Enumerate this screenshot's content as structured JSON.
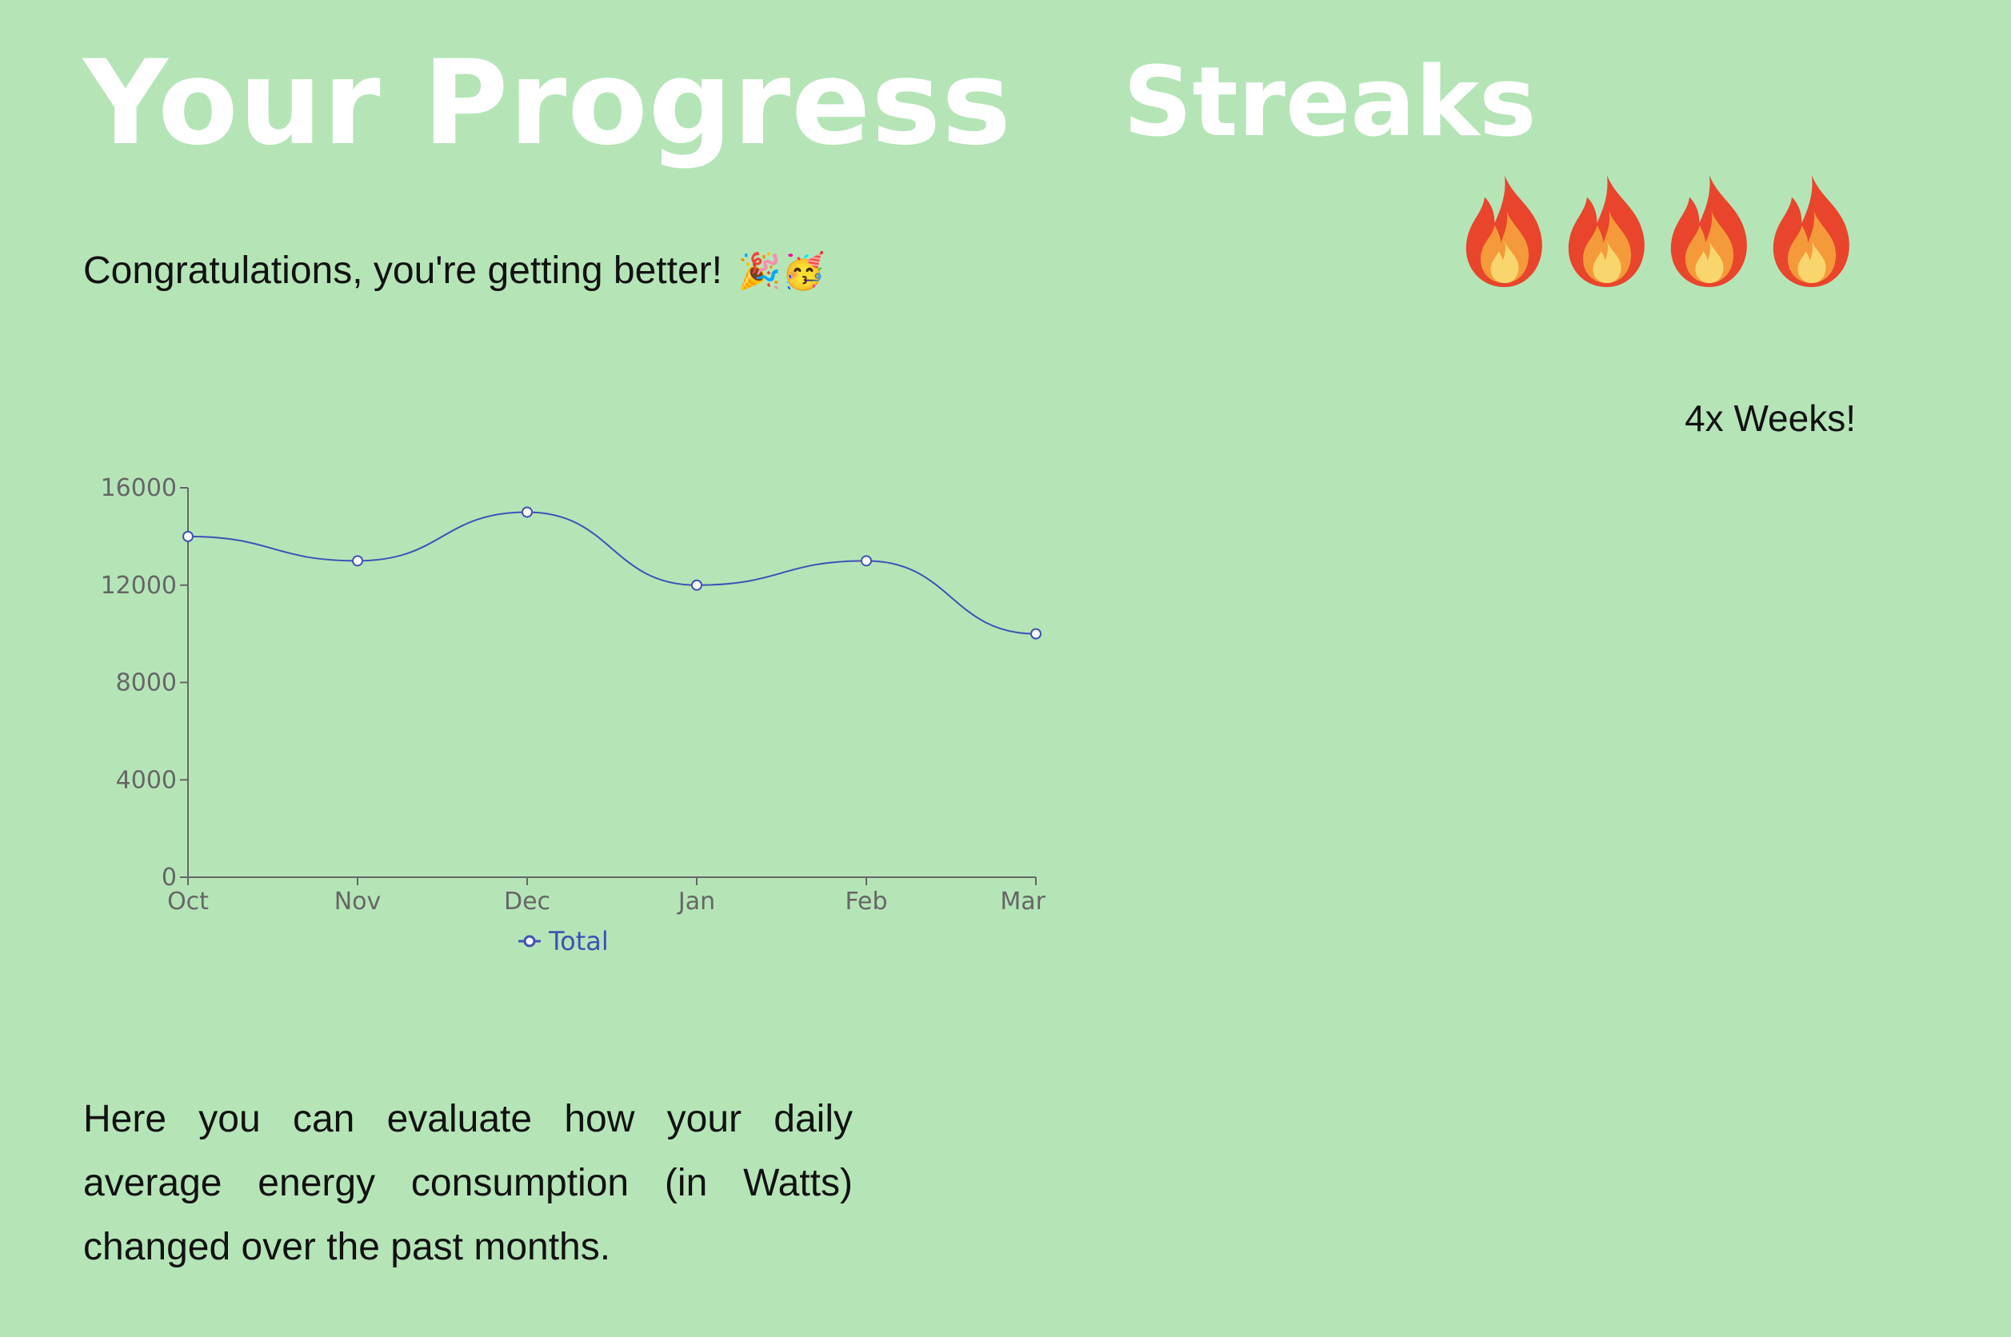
{
  "header": {
    "title": "Your Progress",
    "streaks_title": "Streaks"
  },
  "congrats": {
    "text": "Congratulations, you're getting better!",
    "emoji": "🎉🥳"
  },
  "streaks": {
    "flame_icon": "fire-icon",
    "flame_count": 4,
    "label": "4x Weeks!"
  },
  "description": "Here you can evaluate how your daily average energy consumption (in Watts) changed over the past months.",
  "colors": {
    "background": "#b5e5b7",
    "series": "#3f51b5",
    "axis": "#666666"
  },
  "chart_data": {
    "type": "line",
    "categories": [
      "Oct",
      "Nov",
      "Dec",
      "Jan",
      "Feb",
      "Mar"
    ],
    "series": [
      {
        "name": "Total",
        "values": [
          14000,
          13000,
          15000,
          12000,
          13000,
          10000
        ]
      }
    ],
    "yticks": [
      "0",
      "4000",
      "8000",
      "12000",
      "16000"
    ],
    "ylim": [
      0,
      16000
    ],
    "legend": "bottom-center",
    "grid": false,
    "smooth": true
  }
}
